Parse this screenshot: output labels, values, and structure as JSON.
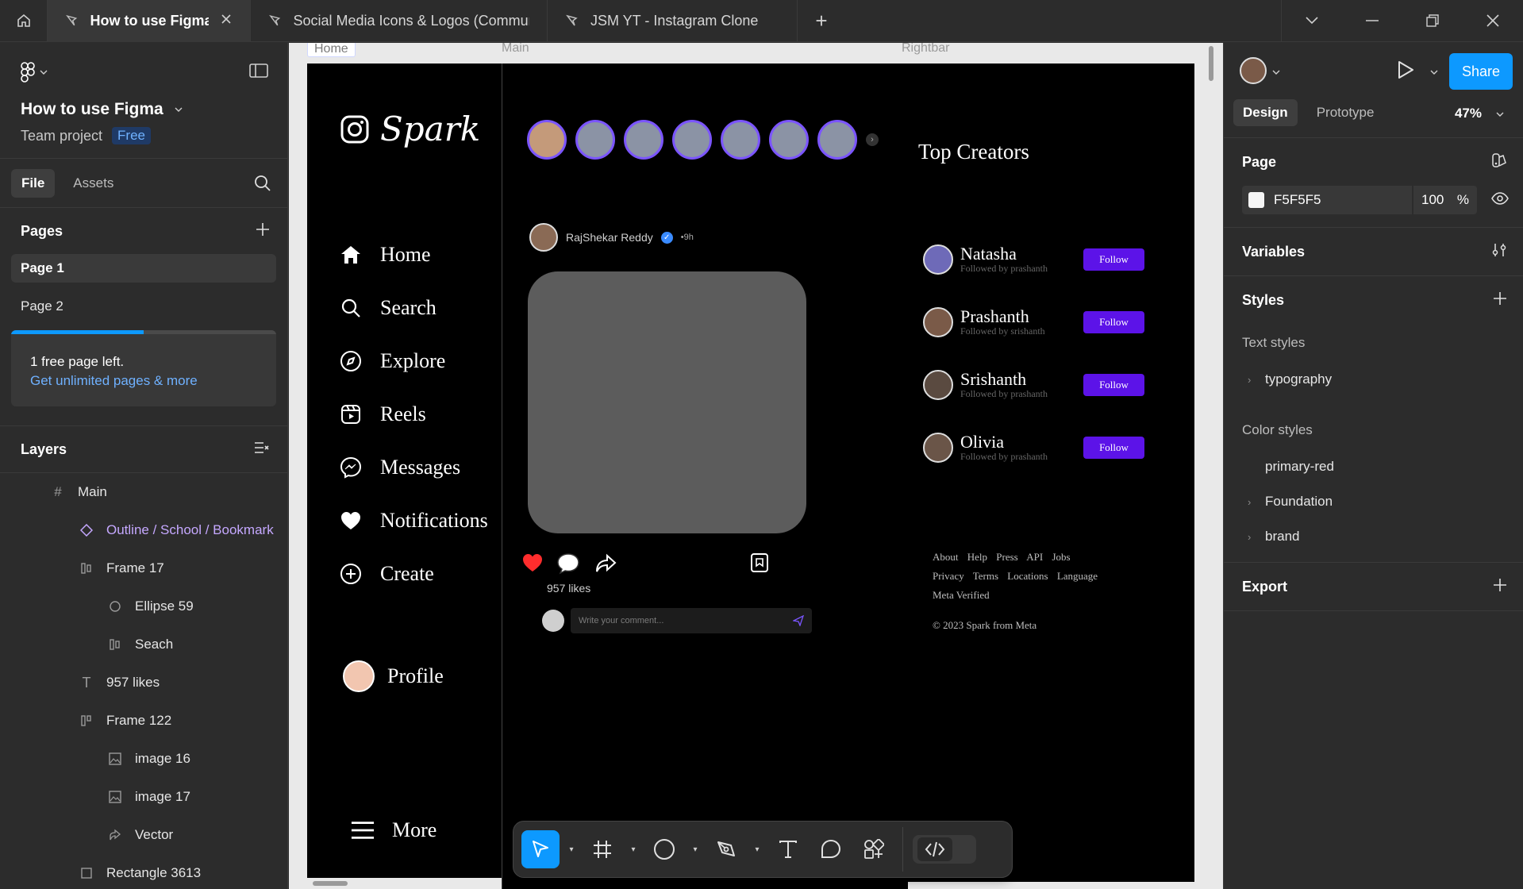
{
  "tabs": [
    {
      "title": "How to use Figma",
      "active": true
    },
    {
      "title": "Social Media Icons & Logos (Commun",
      "active": false
    },
    {
      "title": "JSM YT - Instagram Clone",
      "active": false
    }
  ],
  "file": {
    "name": "How to use Figma",
    "team": "Team project",
    "plan_badge": "Free"
  },
  "left_tabs": {
    "file": "File",
    "assets": "Assets"
  },
  "pages": {
    "heading": "Pages",
    "items": [
      "Page 1",
      "Page 2"
    ],
    "upsell_text": "1 free page left.",
    "upsell_link": "Get unlimited pages & more",
    "usage_fraction": 0.5
  },
  "layers": {
    "heading": "Layers",
    "items": [
      {
        "name": "Main",
        "type": "frame"
      },
      {
        "name": "Outline / School / Bookmark",
        "type": "component"
      },
      {
        "name": "Frame 17",
        "type": "autolayout"
      },
      {
        "name": "Ellipse 59",
        "type": "ellipse"
      },
      {
        "name": "Seach",
        "type": "autolayout"
      },
      {
        "name": "957 likes",
        "type": "text"
      },
      {
        "name": "Frame 122",
        "type": "autolayout"
      },
      {
        "name": "image 16",
        "type": "image"
      },
      {
        "name": "image 17",
        "type": "image"
      },
      {
        "name": "Vector",
        "type": "vector"
      },
      {
        "name": "Rectangle 3613",
        "type": "rectangle"
      }
    ]
  },
  "canvas": {
    "frame_labels": {
      "home": "Home",
      "main": "Main",
      "rightbar": "Rightbar"
    },
    "app": {
      "brand": "Spark",
      "nav": [
        "Home",
        "Search",
        "Explore",
        "Reels",
        "Messages",
        "Notifications",
        "Create"
      ],
      "profile": "Profile",
      "more": "More"
    },
    "post": {
      "author": "RajShekar Reddy",
      "time": "•9h",
      "likes": "957 likes",
      "comment_placeholder": "Write your comment..."
    },
    "rightbar": {
      "title": "Top Creators",
      "creators": [
        {
          "name": "Natasha",
          "sub": "Followed by prashanth"
        },
        {
          "name": "Prashanth",
          "sub": "Followed by srishanth"
        },
        {
          "name": "Srishanth",
          "sub": "Followed by prashanth"
        },
        {
          "name": "Olivia",
          "sub": "Followed by prashanth"
        }
      ],
      "follow_label": "Follow",
      "footer_links": [
        "About",
        "Help",
        "Press",
        "API",
        "Jobs",
        "Privacy",
        "Terms",
        "Locations",
        "Language",
        "Meta Verified"
      ],
      "copyright": "© 2023 Spark from Meta"
    }
  },
  "right_panel": {
    "share_label": "Share",
    "tabs": [
      "Design",
      "Prototype"
    ],
    "zoom": "47%",
    "page": {
      "heading": "Page",
      "fill_hex": "F5F5F5",
      "opacity": "100",
      "opacity_unit": "%"
    },
    "variables": "Variables",
    "styles": "Styles",
    "text_styles": {
      "heading": "Text styles",
      "items": [
        "typography"
      ]
    },
    "color_styles": {
      "heading": "Color styles",
      "items": [
        {
          "name": "primary-red",
          "expandable": false
        },
        {
          "name": "Foundation",
          "expandable": true
        },
        {
          "name": "brand",
          "expandable": true
        }
      ]
    },
    "export": "Export"
  },
  "help_label": "?",
  "colors": {
    "accent": "#0d99ff",
    "follow": "#5c13e8",
    "story_ring": "#7b55ff",
    "page_fill": "#F5F5F5"
  }
}
